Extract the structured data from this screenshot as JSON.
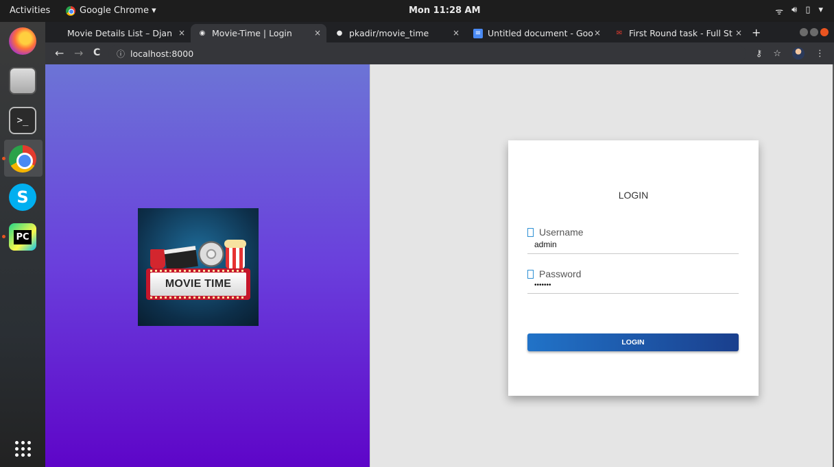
{
  "system": {
    "activities": "Activities",
    "app_name": "Google Chrome ▾",
    "clock": "Mon 11:28 AM",
    "tray": [
      "wifi-icon",
      "volume-icon",
      "battery-icon",
      "menu-down-icon"
    ]
  },
  "dock": {
    "items": [
      "firefox-icon",
      "files-icon",
      "terminal-icon",
      "chrome-icon",
      "skype-icon",
      "pycharm-icon"
    ],
    "terminal_glyph": ">_",
    "skype_glyph": "S",
    "pycharm_glyph": "PC"
  },
  "browser": {
    "tabs": [
      {
        "title": "Movie Details List – Djan",
        "close": "×"
      },
      {
        "title": "Movie-Time | Login",
        "close": "×"
      },
      {
        "title": "pkadir/movie_time",
        "close": "×"
      },
      {
        "title": "Untitled document - Goo",
        "close": "×"
      },
      {
        "title": "First Round task - Full St",
        "close": "×"
      }
    ],
    "new_tab": "+",
    "back": "←",
    "forward": "→",
    "reload": "C",
    "url": "localhost:8000",
    "info_icon": "ⓘ",
    "key_icon": "⚷",
    "star_icon": "☆",
    "menu_icon": "⋮"
  },
  "logo": {
    "text": "MOVIE TIME"
  },
  "login": {
    "title": "LOGIN",
    "username_label": "Username",
    "username_value": "admin",
    "password_label": "Password",
    "password_value": "•••••••",
    "button": "LOGIN"
  },
  "colors": {
    "left_gradient_top": "#6c74d6",
    "left_gradient_bottom": "#5e05c8",
    "button_start": "#2173c8",
    "button_end": "#1a3f8d",
    "icon_accent": "#2c8fd4"
  }
}
